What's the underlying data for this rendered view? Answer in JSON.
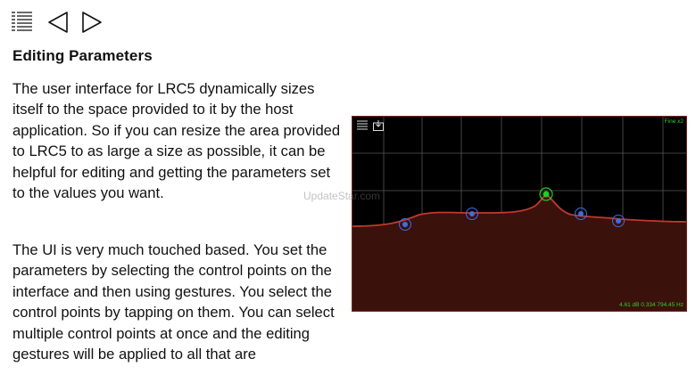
{
  "toolbar": {
    "icons": [
      "list-icon",
      "back-triangle-icon",
      "forward-triangle-icon"
    ]
  },
  "article": {
    "title": "Editing Parameters",
    "paragraphs": [
      "The user interface for LRC5 dynamically sizes itself to the space provided to it by the host application. So if you can resize the area provided to LRC5 to as large a size as possible, it can be helpful for editing and getting the parameters set to the values you want.",
      "The UI is very much touched based. You set the parameters by selecting the control points on the interface and then using gestures. You select the control points by tapping on them. You can select multiple control points at once and the editing gestures will be applied to all that are"
    ]
  },
  "eq_panel": {
    "mode_label": "Fine x2",
    "readout": "4.61 dB 0.334 794.45 Hz",
    "icons": [
      "menu-icon",
      "save-icon"
    ],
    "colors": {
      "background": "#000000",
      "grid": "#5a5a5a",
      "curve": "#c0392b",
      "fill": "#3a0f0a",
      "point": "#3b6fe0",
      "selected_point": "#22cc22"
    }
  },
  "watermark": "UpdateStar.com"
}
